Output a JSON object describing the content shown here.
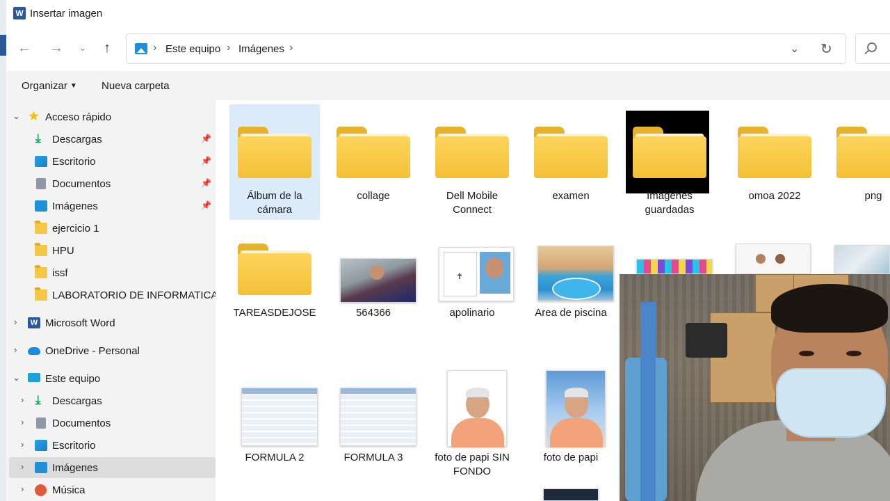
{
  "window": {
    "title": "Insertar imagen",
    "app_badge": "W"
  },
  "address": {
    "crumbs": [
      "Este equipo",
      "Imágenes"
    ],
    "separator": "›"
  },
  "toolbar": {
    "organize_label": "Organizar",
    "new_folder_label": "Nueva carpeta"
  },
  "nav": {
    "quick_access": "Acceso rápido",
    "quick_items": [
      {
        "label": "Descargas",
        "icon": "download-icon",
        "pinned": true
      },
      {
        "label": "Escritorio",
        "icon": "desktop-icon",
        "pinned": true
      },
      {
        "label": "Documentos",
        "icon": "documents-icon",
        "pinned": true
      },
      {
        "label": "Imágenes",
        "icon": "pictures-icon",
        "pinned": true
      },
      {
        "label": "ejercicio 1",
        "icon": "folder-icon",
        "pinned": false
      },
      {
        "label": "HPU",
        "icon": "folder-icon",
        "pinned": false
      },
      {
        "label": "issf",
        "icon": "folder-icon",
        "pinned": false
      },
      {
        "label": "LABORATORIO DE INFORMATICA II",
        "icon": "folder-icon",
        "pinned": false
      }
    ],
    "word": "Microsoft Word",
    "onedrive": "OneDrive - Personal",
    "this_pc": "Este equipo",
    "pc_items": [
      {
        "label": "Descargas",
        "icon": "download-icon"
      },
      {
        "label": "Documentos",
        "icon": "documents-icon"
      },
      {
        "label": "Escritorio",
        "icon": "desktop-icon"
      },
      {
        "label": "Imágenes",
        "icon": "pictures-icon",
        "selected": true
      },
      {
        "label": "Música",
        "icon": "music-icon"
      }
    ]
  },
  "files": {
    "row1": [
      "Álbum de la cámara",
      "collage",
      "Dell Mobile Connect",
      "examen",
      "Imágenes guardadas",
      "omoa 2022",
      "png"
    ],
    "row2": [
      "TAREASDEJOSE",
      "564366",
      "apolinario",
      "Area de piscina"
    ],
    "row3": [
      "FORMULA 2",
      "FORMULA 3",
      "foto de papi SIN FONDO",
      "foto de papi"
    ]
  },
  "colors": {
    "accent": "#2b579a",
    "selection": "#dcebfa",
    "folder": "#f4bf36"
  }
}
